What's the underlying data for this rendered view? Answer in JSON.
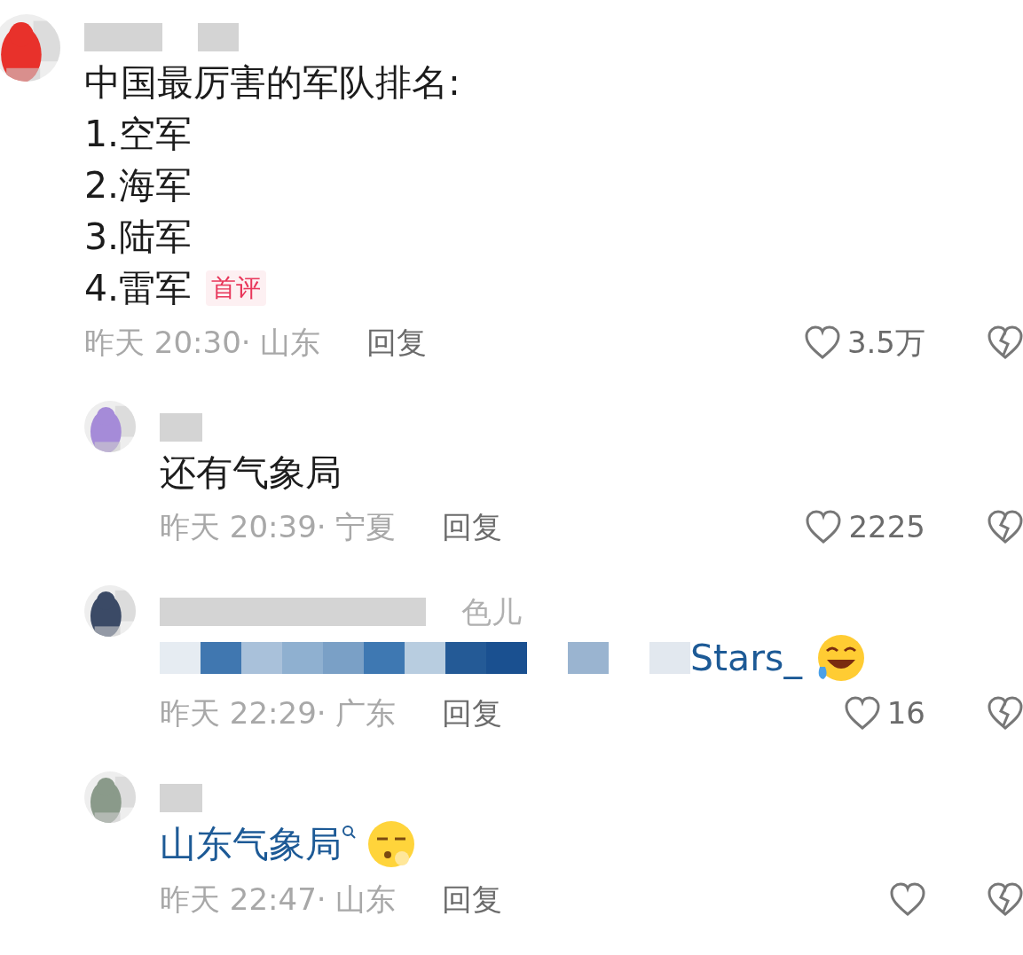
{
  "comments": [
    {
      "avatar": {
        "kind": "picture"
      },
      "lines": [
        [
          {
            "kind": "text",
            "text": "中国最厉害的军队排名:"
          }
        ],
        [
          {
            "kind": "text",
            "text": "1.空军"
          }
        ],
        [
          {
            "kind": "text",
            "text": "2.海军"
          }
        ],
        [
          {
            "kind": "text",
            "text": "3.陆军"
          }
        ],
        [
          {
            "kind": "text",
            "text": "4.雷军"
          },
          {
            "kind": "badge",
            "text": "首评"
          }
        ]
      ],
      "time": "昨天 20:30·",
      "location": "山东",
      "reply": "回复",
      "likes": "3.5万",
      "children": [
        {
          "avatar": {
            "kind": "picture"
          },
          "lines": [
            [
              {
                "kind": "text",
                "text": "还有气象局"
              }
            ]
          ],
          "time": "昨天 20:39·",
          "location": "宁夏",
          "reply": "回复",
          "likes": "2225"
        },
        {
          "avatar": {
            "kind": "picture"
          },
          "name_visible": "色儿",
          "lines": [
            [
              {
                "kind": "blur"
              },
              {
                "kind": "link",
                "text": "Stars_"
              },
              {
                "kind": "laugh"
              }
            ]
          ],
          "time": "昨天 22:29·",
          "location": "广东",
          "reply": "回复",
          "likes": "16"
        },
        {
          "avatar": {
            "kind": "picture"
          },
          "lines": [
            [
              {
                "kind": "search",
                "text": "山东气象局"
              },
              {
                "kind": "pout"
              }
            ]
          ],
          "time": "昨天 22:47·",
          "location": "山东",
          "reply": "回复"
        }
      ]
    }
  ]
}
